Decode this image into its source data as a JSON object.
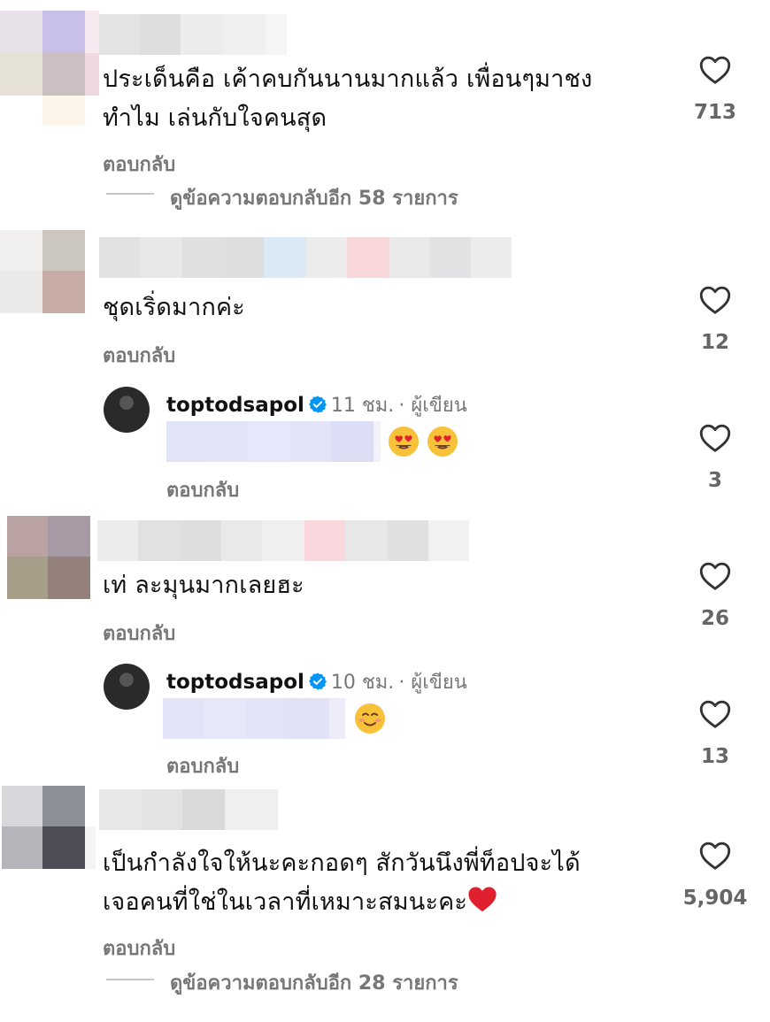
{
  "comments": [
    {
      "text_line1": "ประเด็นคือ เค้าคบกันนานมากแล้ว เพื่อนๆมาชง",
      "text_line2": "ทำไม เล่นกับใจคนสุด",
      "reply_label": "ตอบกลับ",
      "view_replies": "ดูข้อความตอบกลับอีก 58 รายการ",
      "likes": "713"
    },
    {
      "text_line1": "ชุดเริ่ดมากค่ะ",
      "reply_label": "ตอบกลับ",
      "likes": "12",
      "author_reply": {
        "author": "toptodsapol",
        "time": "11 ชม.",
        "role": "· ผู้เขียน",
        "reply_label": "ตอบกลับ",
        "likes": "3"
      }
    },
    {
      "text_line1": "เท่ ละมุนมากเลยฮะ",
      "reply_label": "ตอบกลับ",
      "likes": "26",
      "author_reply": {
        "author": "toptodsapol",
        "time": "10 ชม.",
        "role": "· ผู้เขียน",
        "reply_label": "ตอบกลับ",
        "likes": "13"
      }
    },
    {
      "text_line1": "เป็นกำลังใจให้นะคะกอดๆ สักวันนึงพี่ท็อปจะได้",
      "text_line2": "เจอคนที่ใช่ในเวลาที่เหมาะสมนะคะ",
      "reply_label": "ตอบกลับ",
      "view_replies": "ดูข้อความตอบกลับอีก 28 รายการ",
      "likes": "5,904"
    }
  ],
  "icons": {
    "like": "heart-outline-icon",
    "verified": "verified-badge-icon",
    "heart_eyes": "heart-eyes-emoji",
    "smiling": "smiling-face-emoji",
    "red_heart": "red-heart-emoji"
  },
  "colors": {
    "verified": "#0095f6",
    "muted_text": "#777777",
    "heart_red": "#e0202e"
  }
}
